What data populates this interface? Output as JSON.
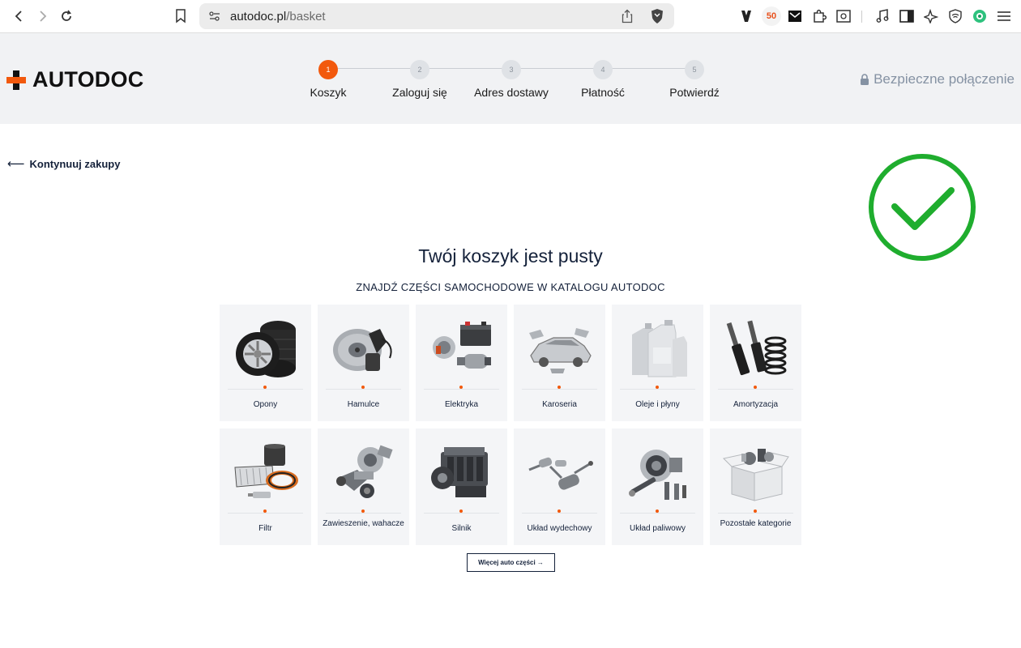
{
  "browser": {
    "url_host": "autodoc.pl",
    "url_path": "/basket",
    "ext_badge": "50"
  },
  "header": {
    "logo_text": "AUTODOC",
    "secure_label": "Bezpieczne połączenie",
    "steps": [
      {
        "number": "1",
        "label": "Koszyk",
        "active": true
      },
      {
        "number": "2",
        "label": "Zaloguj się",
        "active": false
      },
      {
        "number": "3",
        "label": "Adres dostawy",
        "active": false
      },
      {
        "number": "4",
        "label": "Płatność",
        "active": false
      },
      {
        "number": "5",
        "label": "Potwierdź",
        "active": false
      }
    ]
  },
  "main": {
    "continue_label": "Kontynuuj zakupy",
    "title": "Twój koszyk jest pusty",
    "subtitle": "ZNAJDŹ CZĘŚCI SAMOCHODOWE W KATALOGU AUTODOC",
    "categories": [
      {
        "label": "Opony",
        "icon": "tires-icon"
      },
      {
        "label": "Hamulce",
        "icon": "brake-disc-icon"
      },
      {
        "label": "Elektryka",
        "icon": "electrics-icon"
      },
      {
        "label": "Karoseria",
        "icon": "car-body-icon"
      },
      {
        "label": "Oleje i płyny",
        "icon": "oil-canister-icon"
      },
      {
        "label": "Amortyzacja",
        "icon": "shock-absorber-icon"
      },
      {
        "label": "Filtr",
        "icon": "filter-icon"
      },
      {
        "label": "Zawieszenie, wahacze",
        "icon": "suspension-icon"
      },
      {
        "label": "Silnik",
        "icon": "engine-icon"
      },
      {
        "label": "Układ wydechowy",
        "icon": "exhaust-icon"
      },
      {
        "label": "Układ paliwowy",
        "icon": "fuel-system-icon"
      },
      {
        "label": "Pozostałe kategorie",
        "icon": "other-box-icon"
      }
    ],
    "more_button": "Więcej auto części →"
  },
  "colors": {
    "accent": "#f2590d",
    "navy": "#14213a",
    "success": "#1fad2e"
  }
}
